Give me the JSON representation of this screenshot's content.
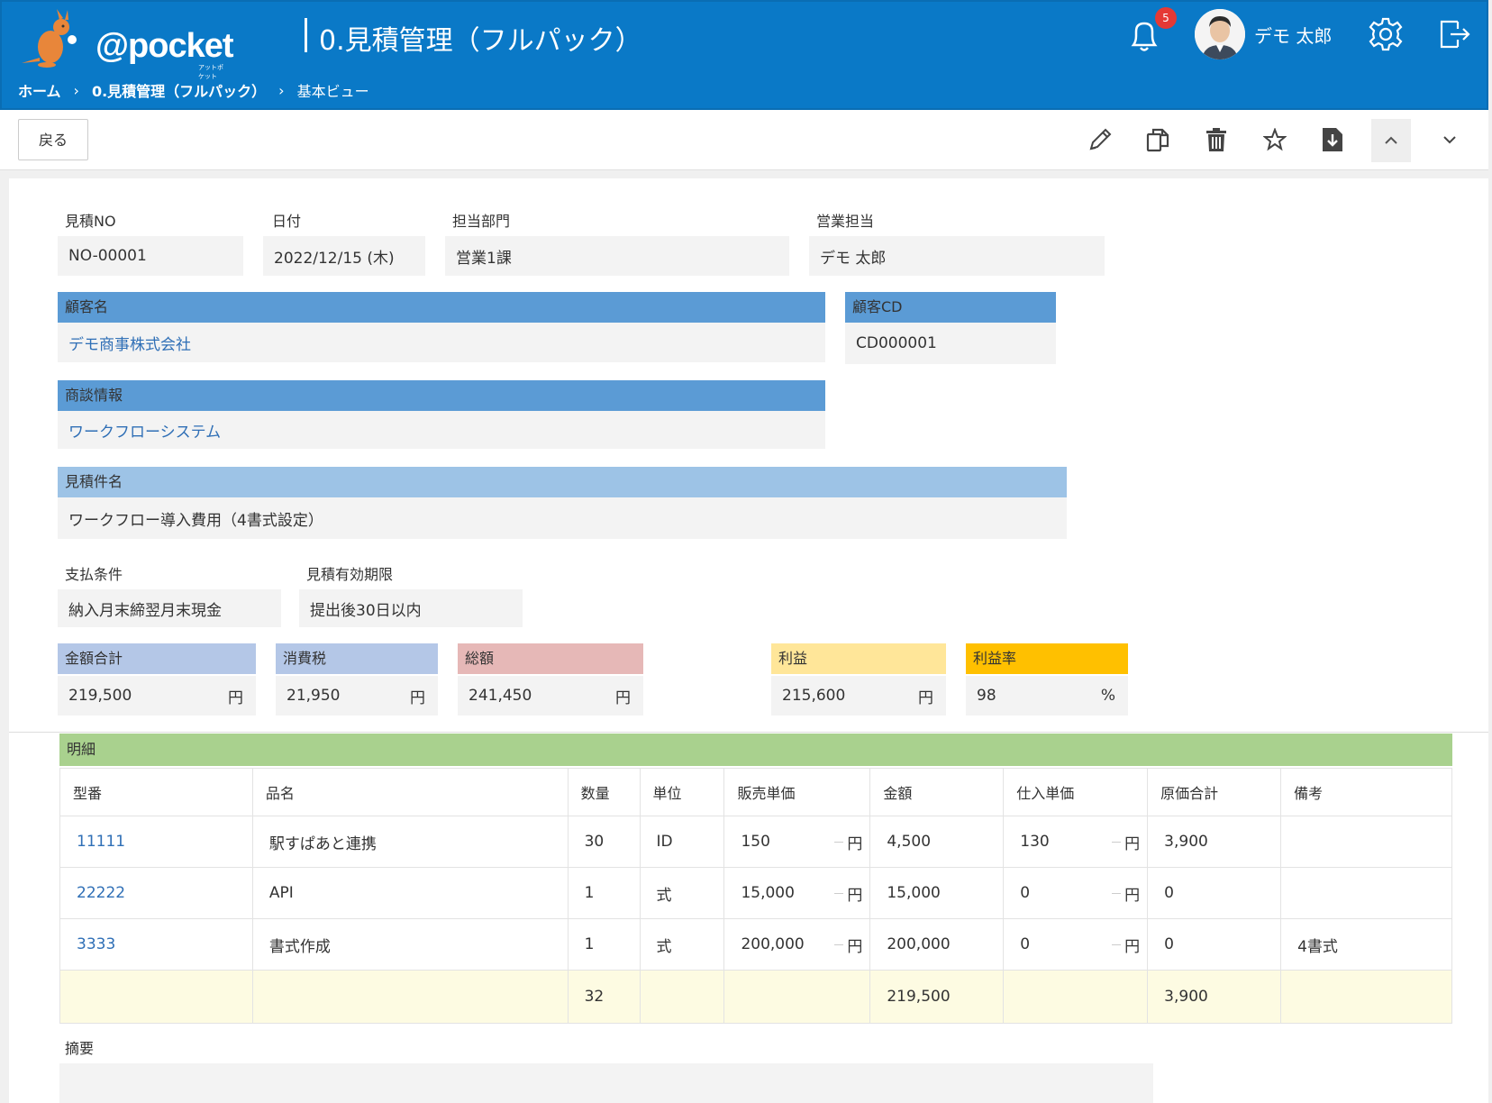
{
  "app": {
    "logo_text": "@pocket",
    "logo_sub": "アットポケット",
    "title": "0.見積管理（フルパック）"
  },
  "breadcrumb": [
    "ホーム",
    "0.見積管理（フルパック）",
    "基本ビュー"
  ],
  "header": {
    "notification_count": "5",
    "user_name": "デモ 太郎"
  },
  "toolbar": {
    "back_label": "戻る"
  },
  "form": {
    "quote_no": {
      "label": "見積NO",
      "value": "NO-00001"
    },
    "date": {
      "label": "日付",
      "value": "2022/12/15 (木)"
    },
    "department": {
      "label": "担当部門",
      "value": "営業1課"
    },
    "sales_rep": {
      "label": "営業担当",
      "value": "デモ 太郎"
    },
    "customer_name": {
      "label": "顧客名",
      "value": "デモ商事株式会社"
    },
    "customer_cd": {
      "label": "顧客CD",
      "value": "CD000001"
    },
    "deal_info": {
      "label": "商談情報",
      "value": "ワークフローシステム"
    },
    "quote_subject": {
      "label": "見積件名",
      "value": "ワークフロー導入費用（4書式設定）"
    },
    "payment_terms": {
      "label": "支払条件",
      "value": "納入月末締翌月末現金"
    },
    "validity": {
      "label": "見積有効期限",
      "value": "提出後30日以内"
    },
    "subtotal": {
      "label": "金額合計",
      "value": "219,500",
      "unit": "円"
    },
    "tax": {
      "label": "消費税",
      "value": "21,950",
      "unit": "円"
    },
    "total": {
      "label": "総額",
      "value": "241,450",
      "unit": "円"
    },
    "profit": {
      "label": "利益",
      "value": "215,600",
      "unit": "円"
    },
    "profit_rate": {
      "label": "利益率",
      "value": "98",
      "unit": "%"
    },
    "summary": {
      "label": "摘要",
      "value": ""
    }
  },
  "details": {
    "title": "明細",
    "columns": [
      "型番",
      "品名",
      "数量",
      "単位",
      "販売単価",
      "金額",
      "仕入単価",
      "原価合計",
      "備考"
    ],
    "yen": "円",
    "rows": [
      {
        "model": "11111",
        "name": "駅すぱあと連携",
        "qty": "30",
        "unit": "ID",
        "price": "150",
        "amount": "4,500",
        "cost_price": "130",
        "cost_total": "3,900",
        "note": ""
      },
      {
        "model": "22222",
        "name": "API",
        "qty": "1",
        "unit": "式",
        "price": "15,000",
        "amount": "15,000",
        "cost_price": "0",
        "cost_total": "0",
        "note": ""
      },
      {
        "model": "3333",
        "name": "書式作成",
        "qty": "1",
        "unit": "式",
        "price": "200,000",
        "amount": "200,000",
        "cost_price": "0",
        "cost_total": "0",
        "note": "4書式"
      }
    ],
    "totals": {
      "qty": "32",
      "amount": "219,500",
      "cost_total": "3,900"
    }
  },
  "colors": {
    "header_bg": "#0a79c7",
    "field_header_blue": "#5b9bd5",
    "field_header_lightblue": "#9dc3e6",
    "sum_header_blue": "#b4c7e7",
    "total_header_pink": "#e6b8b7",
    "profit_header_yellow": "#ffe699",
    "rate_header_gold": "#ffc000",
    "detail_header_green": "#a9d18e",
    "link": "#2f6fb6"
  }
}
